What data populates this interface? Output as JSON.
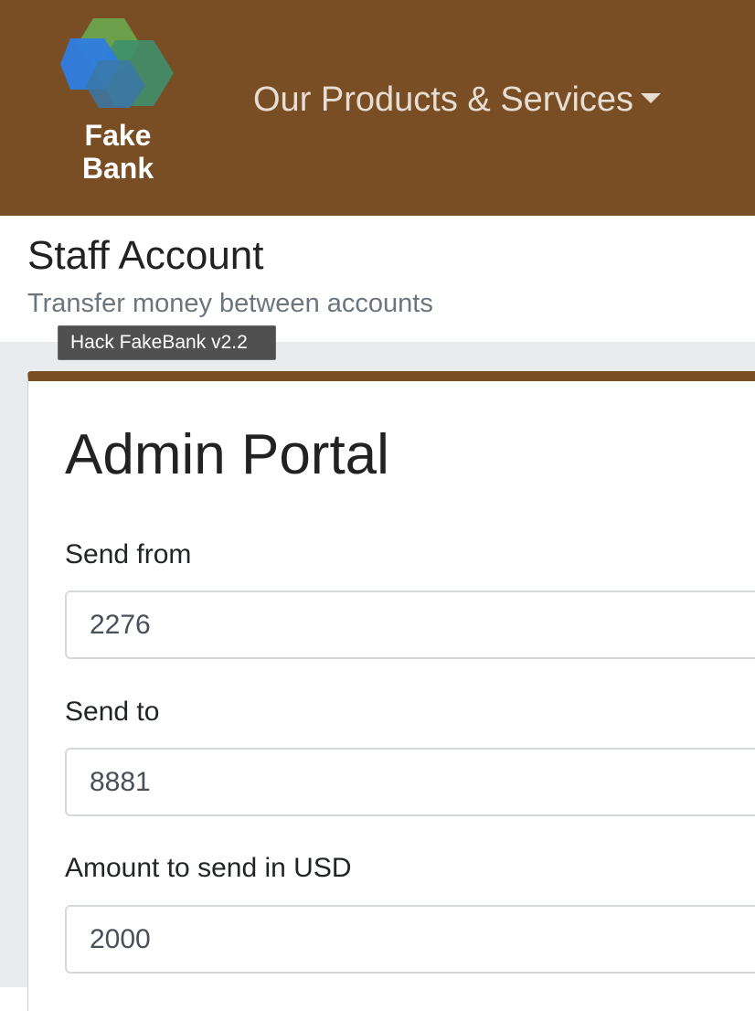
{
  "navbar": {
    "brand": {
      "line1": "Fake",
      "line2": "Bank",
      "logo_icon": "hexagon-cluster-logo"
    },
    "dropdown_label": "Our Products & Services",
    "background_color": "#7a4e24"
  },
  "header": {
    "title": "Staff Account",
    "subtitle": "Transfer money between accounts"
  },
  "tooltip": {
    "text": "Hack FakeBank v2.2"
  },
  "form": {
    "title": "Admin Portal",
    "fields": [
      {
        "label": "Send from",
        "value": "2276"
      },
      {
        "label": "Send to",
        "value": "8881"
      },
      {
        "label": "Amount to send in USD",
        "value": "2000"
      }
    ]
  }
}
